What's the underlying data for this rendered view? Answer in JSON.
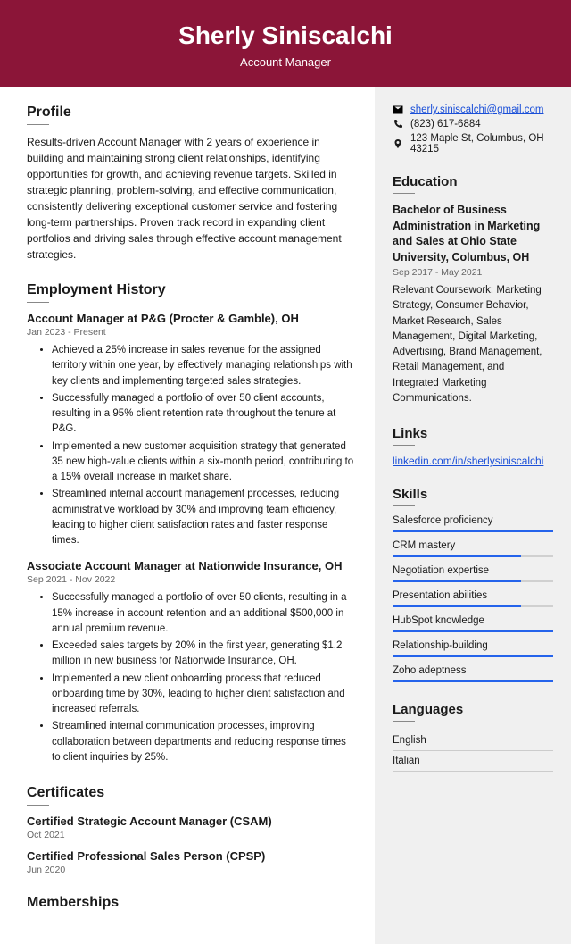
{
  "header": {
    "name": "Sherly Siniscalchi",
    "role": "Account Manager"
  },
  "profile": {
    "title": "Profile",
    "text": "Results-driven Account Manager with 2 years of experience in building and maintaining strong client relationships, identifying opportunities for growth, and achieving revenue targets. Skilled in strategic planning, problem-solving, and effective communication, consistently delivering exceptional customer service and fostering long-term partnerships. Proven track record in expanding client portfolios and driving sales through effective account management strategies."
  },
  "employment": {
    "title": "Employment History",
    "jobs": [
      {
        "title": "Account Manager at P&G (Procter & Gamble), OH",
        "dates": "Jan 2023 - Present",
        "bullets": [
          "Achieved a 25% increase in sales revenue for the assigned territory within one year, by effectively managing relationships with key clients and implementing targeted sales strategies.",
          "Successfully managed a portfolio of over 50 client accounts, resulting in a 95% client retention rate throughout the tenure at P&G.",
          "Implemented a new customer acquisition strategy that generated 35 new high-value clients within a six-month period, contributing to a 15% overall increase in market share.",
          "Streamlined internal account management processes, reducing administrative workload by 30% and improving team efficiency, leading to higher client satisfaction rates and faster response times."
        ]
      },
      {
        "title": "Associate Account Manager at Nationwide Insurance, OH",
        "dates": "Sep 2021 - Nov 2022",
        "bullets": [
          "Successfully managed a portfolio of over 50 clients, resulting in a 15% increase in account retention and an additional $500,000 in annual premium revenue.",
          "Exceeded sales targets by 20% in the first year, generating $1.2 million in new business for Nationwide Insurance, OH.",
          "Implemented a new client onboarding process that reduced onboarding time by 30%, leading to higher client satisfaction and increased referrals.",
          "Streamlined internal communication processes, improving collaboration between departments and reducing response times to client inquiries by 25%."
        ]
      }
    ]
  },
  "certificates": {
    "title": "Certificates",
    "items": [
      {
        "name": "Certified Strategic Account Manager (CSAM)",
        "date": "Oct 2021"
      },
      {
        "name": "Certified Professional Sales Person (CPSP)",
        "date": "Jun 2020"
      }
    ]
  },
  "memberships": {
    "title": "Memberships"
  },
  "contact": {
    "email": "sherly.siniscalchi@gmail.com",
    "phone": "(823) 617-6884",
    "address": "123 Maple St, Columbus, OH 43215"
  },
  "education": {
    "title": "Education",
    "degree": "Bachelor of Business Administration in Marketing and Sales at Ohio State University, Columbus, OH",
    "dates": "Sep 2017 - May 2021",
    "text": "Relevant Coursework: Marketing Strategy, Consumer Behavior, Market Research, Sales Management, Digital Marketing, Advertising, Brand Management, Retail Management, and Integrated Marketing Communications."
  },
  "links": {
    "title": "Links",
    "url": "linkedin.com/in/sherlysiniscalchi"
  },
  "skills": {
    "title": "Skills",
    "items": [
      {
        "name": "Salesforce proficiency",
        "level": 100
      },
      {
        "name": "CRM mastery",
        "level": 80
      },
      {
        "name": "Negotiation expertise",
        "level": 80
      },
      {
        "name": "Presentation abilities",
        "level": 80
      },
      {
        "name": "HubSpot knowledge",
        "level": 100
      },
      {
        "name": "Relationship-building",
        "level": 100
      },
      {
        "name": "Zoho adeptness",
        "level": 100
      }
    ]
  },
  "languages": {
    "title": "Languages",
    "items": [
      "English",
      "Italian"
    ]
  }
}
